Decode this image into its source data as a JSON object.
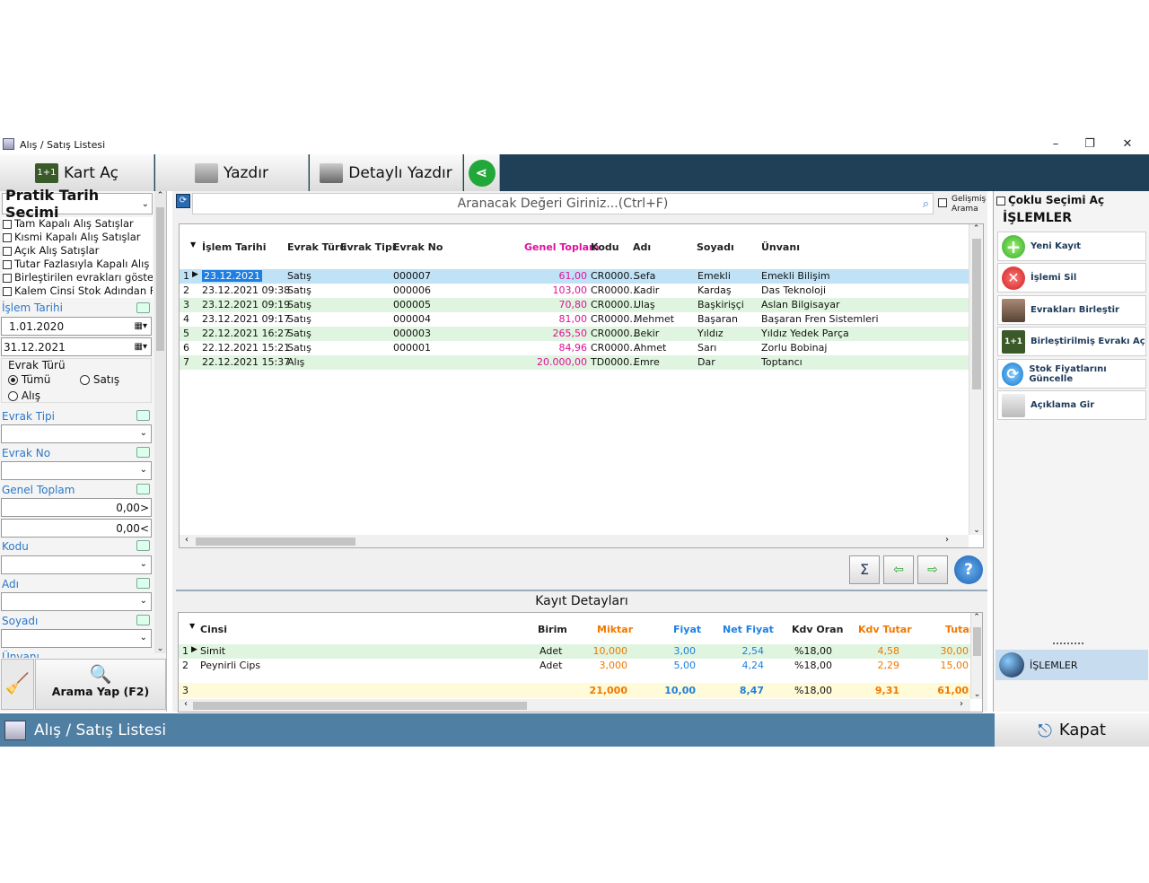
{
  "window": {
    "title": "Alış / Satış Listesi"
  },
  "toolbar": {
    "kart_ac": "Kart Aç",
    "yazdir": "Yazdır",
    "detayli_yazdir": "Detaylı Yazdır"
  },
  "left": {
    "header": "Pratik Tarih Seçimi",
    "checks": [
      "Tam Kapalı Alış Satışlar",
      "Kısmi Kapalı Alış Satışlar",
      "Açık Alış Satışlar",
      "Tutar Fazlasıyla Kapalı Alış S",
      "Birleştirilen evrakları göster",
      "Kalem Cinsi Stok Adından Fa"
    ],
    "islem_tarihi": "İşlem Tarihi",
    "date_from": "1.01.2020",
    "date_to": "31.12.2021",
    "evrak_turu": "Evrak Türü",
    "radio_tumu": "Tümü",
    "radio_satis": "Satış",
    "radio_alis": "Alış",
    "evrak_tipi": "Evrak Tipi",
    "evrak_no": "Evrak No",
    "genel_toplam": "Genel Toplam",
    "gt_from": "0,00>",
    "gt_to": "0,00<",
    "kodu": "Kodu",
    "adi": "Adı",
    "soyadi": "Soyadı",
    "unvani": "Ünvanı",
    "search_btn": "Arama Yap (F2)"
  },
  "search": {
    "placeholder": "Aranacak Değeri Giriniz...(Ctrl+F)",
    "gelismis": "Gelişmiş",
    "arama": "Arama"
  },
  "grid": {
    "headers": [
      "İşlem Tarihi",
      "Evrak Türü",
      "Evrak Tipi",
      "Evrak No",
      "Genel Toplam",
      "Kodu",
      "Adı",
      "Soyadı",
      "Ünvanı"
    ],
    "rows": [
      {
        "n": "1",
        "date": "23.12.2021",
        "type": "Satış",
        "no": "000007",
        "total": "61,00",
        "code": "CR0000...",
        "name": "Sefa",
        "surname": "Emekli",
        "title": "Emekli Bilişim"
      },
      {
        "n": "2",
        "date": "23.12.2021 09:38",
        "type": "Satış",
        "no": "000006",
        "total": "103,00",
        "code": "CR0000...",
        "name": "Kadir",
        "surname": "Kardaş",
        "title": "Das Teknoloji"
      },
      {
        "n": "3",
        "date": "23.12.2021 09:19",
        "type": "Satış",
        "no": "000005",
        "total": "70,80",
        "code": "CR0000...",
        "name": "Ulaş",
        "surname": "Başkirişçi",
        "title": "Aslan Bilgisayar"
      },
      {
        "n": "4",
        "date": "23.12.2021 09:17",
        "type": "Satış",
        "no": "000004",
        "total": "81,00",
        "code": "CR0000...",
        "name": "Mehmet",
        "surname": "Başaran",
        "title": "Başaran Fren Sistemleri"
      },
      {
        "n": "5",
        "date": "22.12.2021 16:27",
        "type": "Satış",
        "no": "000003",
        "total": "265,50",
        "code": "CR0000...",
        "name": "Bekir",
        "surname": "Yıldız",
        "title": "Yıldız Yedek Parça"
      },
      {
        "n": "6",
        "date": "22.12.2021 15:21",
        "type": "Satış",
        "no": "000001",
        "total": "84,96",
        "code": "CR0000...",
        "name": "Ahmet",
        "surname": "Sarı",
        "title": "Zorlu Bobinaj"
      },
      {
        "n": "7",
        "date": "22.12.2021 15:37",
        "type": "Alış",
        "no": "",
        "total": "20.000,00",
        "code": "TD0000...",
        "name": "Emre",
        "surname": "Dar",
        "title": "Toptancı"
      }
    ]
  },
  "details": {
    "title": "Kayıt Detayları",
    "headers": [
      "Cinsi",
      "Birim",
      "Miktar",
      "Fiyat",
      "Net Fiyat",
      "Kdv Oran",
      "Kdv Tutar",
      "Tutar"
    ],
    "rows": [
      {
        "n": "1",
        "cinsi": "Simit",
        "birim": "Adet",
        "miktar": "10,000",
        "fiyat": "3,00",
        "net": "2,54",
        "kdv": "%18,00",
        "kdvt": "4,58",
        "tutar": "30,00"
      },
      {
        "n": "2",
        "cinsi": "Peynirli Cips",
        "birim": "Adet",
        "miktar": "3,000",
        "fiyat": "5,00",
        "net": "4,24",
        "kdv": "%18,00",
        "kdvt": "2,29",
        "tutar": "15,00"
      }
    ],
    "total": {
      "n": "3",
      "miktar": "21,000",
      "fiyat": "10,00",
      "net": "8,47",
      "kdv": "%18,00",
      "kdvt": "9,31",
      "tutar": "61,00"
    }
  },
  "right": {
    "coklu": "Çoklu Seçimi Aç",
    "islemler": "İŞLEMLER",
    "buttons": [
      "Yeni Kayıt",
      "İşlemi Sil",
      "Evrakları Birleştir",
      "Birleştirilmiş Evrakı Aç",
      "Stok Fiyatlarını Güncelle",
      "Açıklama Gir"
    ],
    "nav": "İŞLEMLER"
  },
  "bottom": {
    "title": "Alış / Satış Listesi",
    "kapat": "Kapat"
  }
}
